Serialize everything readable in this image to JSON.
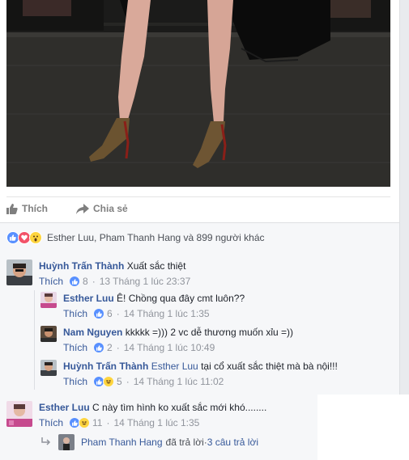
{
  "post": {
    "actions": {
      "like_label": "Thích",
      "share_label": "Chia sẻ"
    },
    "reactions": {
      "icons": [
        "like-icon",
        "love-icon",
        "wow-icon"
      ],
      "summary": "Esther Luu, Pham Thanh Hang và 899 người khác"
    }
  },
  "comments": [
    {
      "author": "Huỳnh Trấn Thành",
      "tag": "",
      "text": "Xuất sắc thiệt",
      "like_label": "Thích",
      "reaction_count": "8",
      "time": "13 Tháng 1 lúc 23:37",
      "replies": [
        {
          "author": "Esther Luu",
          "tag": "",
          "text": "Ê! Chồng qua đây cmt luôn??",
          "like_label": "Thích",
          "reaction_count": "6",
          "time": "14 Tháng 1 lúc 1:35"
        },
        {
          "author": "Nam Nguyen",
          "tag": "",
          "text": "kkkkk =))) 2 vc dễ thương muốn xỉu =))",
          "like_label": "Thích",
          "reaction_count": "2",
          "time": "14 Tháng 1 lúc 10:49"
        },
        {
          "author": "Huỳnh Trấn Thành",
          "tag": "Esther Luu",
          "text": "tại cổ xuất sắc thiệt mà bà nội!!!",
          "like_label": "Thích",
          "reaction_count": "5",
          "time": "14 Tháng 1 lúc 11:02"
        }
      ]
    },
    {
      "author": "Esther Luu",
      "tag": "",
      "text": "C này tìm hình ko xuất sắc mới khó........",
      "like_label": "Thích",
      "reaction_count": "11",
      "time": "14 Tháng 1 lúc 1:35",
      "more_replies": {
        "name": "Pham Thanh Hang",
        "text": "đã trả lời",
        "separator": " · ",
        "count_label": "3 câu trả lời"
      }
    }
  ],
  "colors": {
    "link": "#365899",
    "meta": "#90949c",
    "like_reaction": "#5890ff",
    "love_reaction": "#f25268",
    "haha_reaction": "#fed53f"
  }
}
